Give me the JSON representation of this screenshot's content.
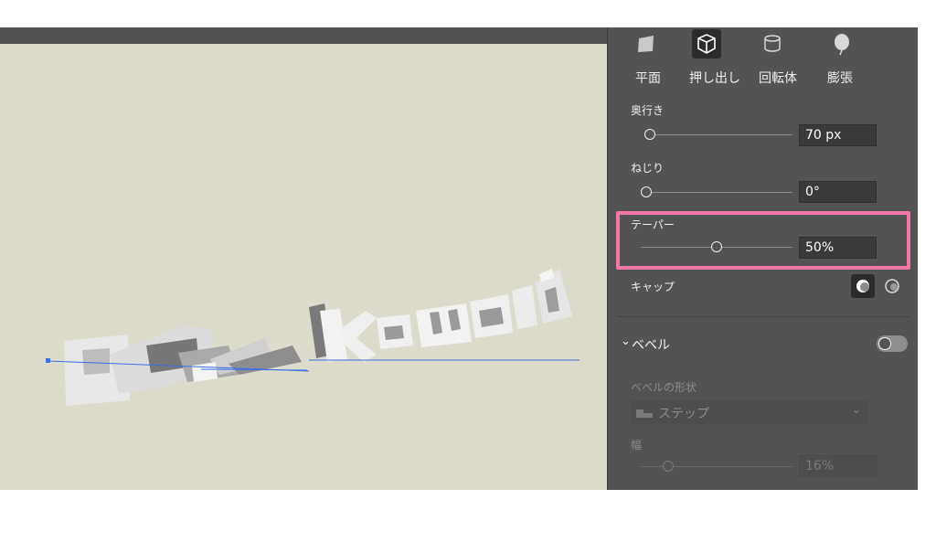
{
  "panel": {
    "modes": [
      {
        "label": "平面",
        "icon": "plane-icon"
      },
      {
        "label": "押し出し",
        "icon": "extrude-icon"
      },
      {
        "label": "回転体",
        "icon": "revolve-icon"
      },
      {
        "label": "膨張",
        "icon": "inflate-icon"
      }
    ],
    "depth": {
      "label": "奥行き",
      "value": "70 px"
    },
    "twist": {
      "label": "ねじり",
      "value": "0°"
    },
    "taper": {
      "label": "テーパー",
      "value": "50%"
    },
    "cap": {
      "label": "キャップ"
    },
    "bevel": {
      "title": "ベベル",
      "shape_label": "ベベルの形状",
      "shape_value": "ステップ",
      "width_label": "幅",
      "width_value": "16%"
    }
  },
  "canvas": {
    "text": "Kawaii"
  },
  "colors": {
    "highlight": "#f277a8",
    "panel": "#535353",
    "canvas": "#dddccc",
    "path": "#3b6fe0"
  }
}
